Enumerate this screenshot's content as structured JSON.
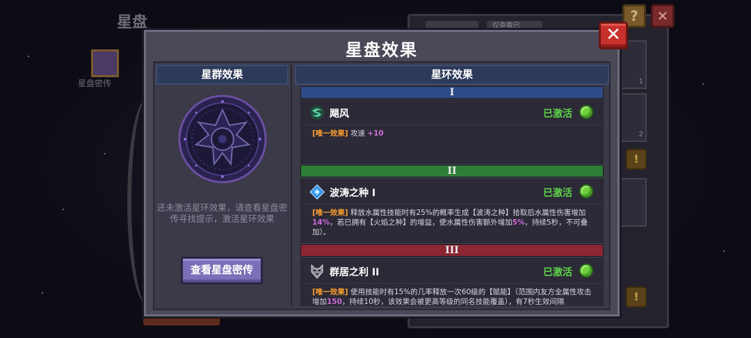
{
  "background": {
    "page_title": "星盘",
    "book_label": "星盘密传",
    "tabs": [
      "",
      "仅查看已"
    ],
    "card_counts": [
      "1",
      "2"
    ],
    "help_glyph": "?",
    "close_glyph": "✕",
    "warn_glyph": "!"
  },
  "modal": {
    "title": "星盘效果",
    "close_glyph": "✕"
  },
  "cluster": {
    "header": "星群效果",
    "hint": "还未激活星环效果，请查看星盘密传寻找提示，激活星环效果",
    "lore_button": "查看星盘密传"
  },
  "ring": {
    "header": "星环效果",
    "tiers": [
      {
        "numeral": "I",
        "color": "#2d4b86",
        "effect": {
          "name": "飓风",
          "icon": "cyclone-icon",
          "status": "已激活",
          "tag": "[唯一效果]",
          "desc_parts": [
            " 攻速 ",
            "+10"
          ]
        }
      },
      {
        "numeral": "II",
        "color": "#2f7d34",
        "effect": {
          "name": "波涛之种 I",
          "icon": "water-crystal-icon",
          "status": "已激活",
          "tag": "[唯一效果]",
          "desc_parts": [
            " 释放水属性技能时有25%的概率生成【波涛之种】拾取后水属性伤害增加",
            "14%",
            "，若已拥有【火焰之种】的增益，使水属性伤害额外增加",
            "5%",
            "，持续5秒，不可叠加）。"
          ]
        }
      },
      {
        "numeral": "III",
        "color": "#8a2733",
        "effect": {
          "name": "群居之利 II",
          "icon": "wolf-icon",
          "status": "已激活",
          "tag": "[唯一效果]",
          "desc_parts": [
            " 使用技能时有15%的几率释放一次60级的【赋能】（范围内友方全属性攻击增加",
            "150",
            "，持续10秒，该效果会被更高等级的同名技能覆盖），有7秒生效间隔"
          ]
        }
      }
    ]
  }
}
